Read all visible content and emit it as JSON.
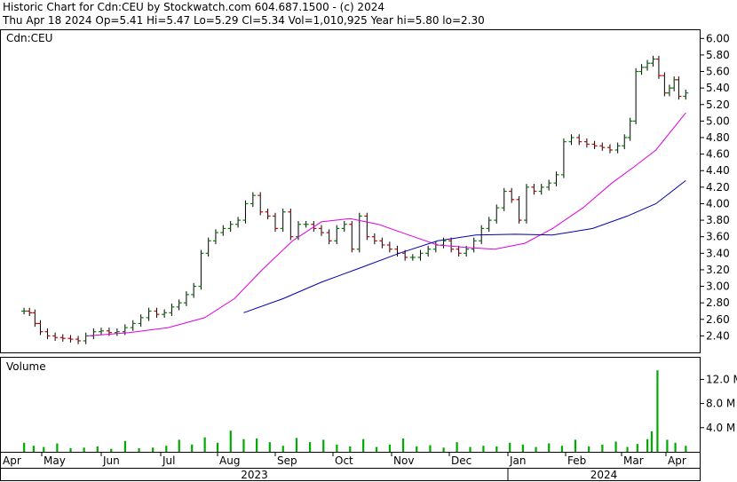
{
  "header": {
    "line1": "Historic Chart for Cdn:CEU by Stockwatch.com 604.687.1500 - (c) 2024",
    "line2": "Thu Apr 18 2024   Op=5.41  Hi=5.47  Lo=5.29  Cl=5.34  Vol=1,010,925  Year hi=5.80  lo=2.30"
  },
  "colors": {
    "up": "#008000",
    "down": "#cc0000",
    "ma_short": "#e000e0",
    "ma_long": "#0000b0",
    "volume": "#00aa00"
  },
  "chart_data": {
    "type": "line",
    "symbol_label": "Cdn:CEU",
    "volume_label": "Volume",
    "price_axis": {
      "ylim": [
        2.2,
        6.1
      ],
      "ticks": [
        2.4,
        2.6,
        2.8,
        3.0,
        3.2,
        3.4,
        3.6,
        3.8,
        4.0,
        4.2,
        4.4,
        4.6,
        4.8,
        5.0,
        5.2,
        5.4,
        5.6,
        5.8,
        6.0
      ],
      "tick_labels": [
        "2.40",
        "2.60",
        "2.80",
        "3.00",
        "3.20",
        "3.40",
        "3.60",
        "3.80",
        "4.00",
        "4.20",
        "4.40",
        "4.60",
        "4.80",
        "5.00",
        "5.20",
        "5.40",
        "5.60",
        "5.80",
        "6.00"
      ]
    },
    "volume_axis": {
      "ylim": [
        0,
        15
      ],
      "ticks": [
        4,
        8,
        12
      ],
      "tick_labels": [
        "4.0 M",
        "8.0 M",
        "12.0 M"
      ],
      "unit": "M"
    },
    "x_axis": {
      "months": [
        "Apr",
        "May",
        "Jun",
        "Jul",
        "Aug",
        "Sep",
        "Oct",
        "Nov",
        "Dec",
        "Jan",
        "Feb",
        "Mar",
        "Apr"
      ],
      "years": [
        "2023",
        "2024"
      ]
    },
    "series": [
      {
        "role": "price",
        "x": [
          "2023-04-18",
          "2023-04-22",
          "2023-04-26",
          "2023-04-30",
          "2023-05-04",
          "2023-05-08",
          "2023-05-12",
          "2023-05-16",
          "2023-05-20",
          "2023-05-24",
          "2023-05-28",
          "2023-06-01",
          "2023-06-05",
          "2023-06-09",
          "2023-06-13",
          "2023-06-17",
          "2023-06-21",
          "2023-06-25",
          "2023-06-29",
          "2023-07-03",
          "2023-07-07",
          "2023-07-11",
          "2023-07-15",
          "2023-07-19",
          "2023-07-23",
          "2023-07-27",
          "2023-07-31",
          "2023-08-04",
          "2023-08-08",
          "2023-08-12",
          "2023-08-16",
          "2023-08-20",
          "2023-08-24",
          "2023-08-28",
          "2023-09-01",
          "2023-09-05",
          "2023-09-09",
          "2023-09-13",
          "2023-09-17",
          "2023-09-21",
          "2023-09-25",
          "2023-09-29",
          "2023-10-03",
          "2023-10-07",
          "2023-10-11",
          "2023-10-15",
          "2023-10-19",
          "2023-10-23",
          "2023-10-27",
          "2023-10-31",
          "2023-11-04",
          "2023-11-08",
          "2023-11-12",
          "2023-11-16",
          "2023-11-20",
          "2023-11-24",
          "2023-11-28",
          "2023-12-02",
          "2023-12-06",
          "2023-12-10",
          "2023-12-14",
          "2023-12-18",
          "2023-12-22",
          "2023-12-26",
          "2023-12-30",
          "2024-01-03",
          "2024-01-07",
          "2024-01-11",
          "2024-01-15",
          "2024-01-19",
          "2024-01-23",
          "2024-01-27",
          "2024-01-31",
          "2024-02-04",
          "2024-02-08",
          "2024-02-12",
          "2024-02-16",
          "2024-02-20",
          "2024-02-24",
          "2024-02-28",
          "2024-03-03",
          "2024-03-07",
          "2024-03-11",
          "2024-03-15",
          "2024-03-19",
          "2024-03-23",
          "2024-03-27",
          "2024-03-31",
          "2024-04-04",
          "2024-04-08",
          "2024-04-12",
          "2024-04-18"
        ],
        "values": [
          2.7,
          2.68,
          2.55,
          2.45,
          2.4,
          2.38,
          2.37,
          2.36,
          2.34,
          2.4,
          2.45,
          2.46,
          2.44,
          2.45,
          2.5,
          2.55,
          2.62,
          2.7,
          2.66,
          2.68,
          2.75,
          2.8,
          2.9,
          3.0,
          3.4,
          3.55,
          3.65,
          3.7,
          3.75,
          3.8,
          4.0,
          4.1,
          3.9,
          3.85,
          3.7,
          3.9,
          3.6,
          3.75,
          3.75,
          3.7,
          3.65,
          3.55,
          3.7,
          3.75,
          3.45,
          3.85,
          3.6,
          3.55,
          3.5,
          3.45,
          3.4,
          3.35,
          3.35,
          3.4,
          3.45,
          3.5,
          3.55,
          3.45,
          3.4,
          3.45,
          3.55,
          3.7,
          3.8,
          3.95,
          4.15,
          4.05,
          3.8,
          4.2,
          4.15,
          4.2,
          4.25,
          4.35,
          4.75,
          4.8,
          4.75,
          4.72,
          4.7,
          4.68,
          4.65,
          4.7,
          4.8,
          5.0,
          5.6,
          5.65,
          5.7,
          5.75,
          5.55,
          5.34,
          5.4,
          5.5,
          5.3,
          5.34
        ]
      },
      {
        "role": "moving-average-short",
        "x": [
          "2023-05-25",
          "2023-06-15",
          "2023-07-05",
          "2023-07-25",
          "2023-08-10",
          "2023-08-25",
          "2023-09-10",
          "2023-09-25",
          "2023-10-10",
          "2023-10-25",
          "2023-11-10",
          "2023-11-25",
          "2023-12-10",
          "2023-12-25",
          "2024-01-10",
          "2024-01-25",
          "2024-02-10",
          "2024-02-25",
          "2024-03-10",
          "2024-03-25",
          "2024-04-18"
        ],
        "values": [
          2.4,
          2.44,
          2.5,
          2.62,
          2.85,
          3.2,
          3.55,
          3.78,
          3.82,
          3.75,
          3.62,
          3.5,
          3.47,
          3.45,
          3.52,
          3.7,
          3.95,
          4.25,
          4.45,
          4.65,
          5.1
        ]
      },
      {
        "role": "moving-average-long",
        "x": [
          "2023-08-15",
          "2023-09-05",
          "2023-09-25",
          "2023-10-15",
          "2023-11-05",
          "2023-11-25",
          "2023-12-15",
          "2024-01-05",
          "2024-01-25",
          "2024-02-15",
          "2024-03-05",
          "2024-03-25",
          "2024-04-18"
        ],
        "values": [
          2.68,
          2.85,
          3.05,
          3.22,
          3.4,
          3.55,
          3.62,
          3.63,
          3.62,
          3.7,
          3.85,
          4.0,
          4.28
        ]
      },
      {
        "role": "volume",
        "x": [
          "2023-04-18",
          "2023-04-25",
          "2023-05-02",
          "2023-05-09",
          "2023-05-16",
          "2023-05-23",
          "2023-05-30",
          "2023-06-06",
          "2023-06-13",
          "2023-06-20",
          "2023-06-27",
          "2023-07-04",
          "2023-07-11",
          "2023-07-18",
          "2023-07-25",
          "2023-08-01",
          "2023-08-08",
          "2023-08-15",
          "2023-08-22",
          "2023-08-29",
          "2023-09-05",
          "2023-09-12",
          "2023-09-19",
          "2023-09-26",
          "2023-10-03",
          "2023-10-10",
          "2023-10-17",
          "2023-10-24",
          "2023-10-31",
          "2023-11-07",
          "2023-11-14",
          "2023-11-21",
          "2023-11-28",
          "2023-12-05",
          "2023-12-12",
          "2023-12-19",
          "2023-12-26",
          "2024-01-02",
          "2024-01-09",
          "2024-01-16",
          "2024-01-23",
          "2024-01-30",
          "2024-02-06",
          "2024-02-13",
          "2024-02-20",
          "2024-02-27",
          "2024-03-05",
          "2024-03-12",
          "2024-03-19",
          "2024-03-22",
          "2024-03-26",
          "2024-04-02",
          "2024-04-09",
          "2024-04-18"
        ],
        "values": [
          1.5,
          1.0,
          0.8,
          1.4,
          0.6,
          0.7,
          0.9,
          0.5,
          1.8,
          0.6,
          0.7,
          1.0,
          2.0,
          1.2,
          2.4,
          1.5,
          3.5,
          2.1,
          2.2,
          1.6,
          1.0,
          2.3,
          1.6,
          2.0,
          1.2,
          0.9,
          2.1,
          0.8,
          1.2,
          2.2,
          0.9,
          1.1,
          0.7,
          1.6,
          0.8,
          1.0,
          0.9,
          1.5,
          1.2,
          0.8,
          1.4,
          1.0,
          2.0,
          0.9,
          1.2,
          1.7,
          0.8,
          1.3,
          2.1,
          3.4,
          13.5,
          2.0,
          1.5,
          1.0
        ]
      }
    ]
  }
}
